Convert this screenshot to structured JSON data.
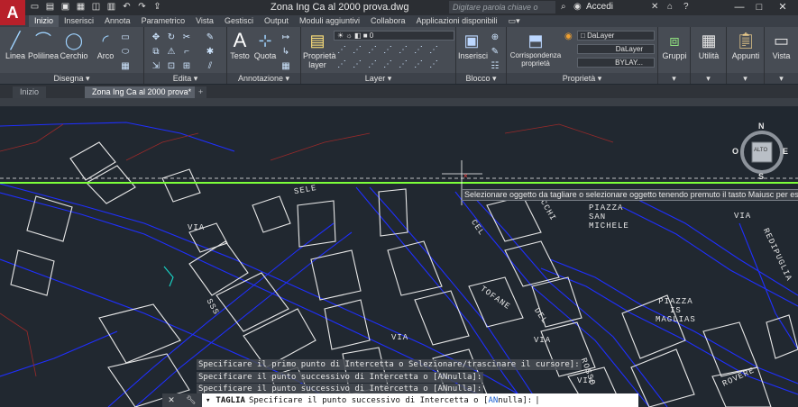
{
  "titlebar": {
    "app_letter": "A",
    "qat_icons": [
      "new-icon",
      "open-icon",
      "save-icon",
      "saveas-icon",
      "web-icon",
      "plot-icon",
      "undo-icon",
      "redo-icon",
      "share-icon"
    ],
    "doc_title": "Zona Ing Ca al 2000 prova.dwg",
    "search_placeholder": "Digitare parola chiave o frase",
    "login_label": "Accedi",
    "minimize": "—",
    "maximize": "□",
    "close": "✕"
  },
  "ribbon_tabs": [
    "Inizio",
    "Inserisci",
    "Annota",
    "Parametrico",
    "Vista",
    "Gestisci",
    "Output",
    "Moduli aggiuntivi",
    "Collabora",
    "Applicazioni disponibili"
  ],
  "ribbon": {
    "draw": {
      "label": "Disegna ▾",
      "tools": [
        "Linea",
        "Polilinea",
        "Cerchio",
        "Arco"
      ]
    },
    "modify": {
      "label": "Edita ▾"
    },
    "annotation": {
      "label": "Annotazione ▾",
      "tools": [
        "Testo",
        "Quota"
      ]
    },
    "layer": {
      "label": "Layer ▾",
      "props_label": "Proprietà layer",
      "current_layer": "0"
    },
    "block": {
      "label": "Blocco ▾",
      "insert_label": "Inserisci"
    },
    "properties": {
      "label": "Proprietà ▾",
      "match_label": "Corrispondenza proprietà",
      "color": "DaLayer",
      "linetype": "DaLayer",
      "lineweight": "BYLAY..."
    },
    "groups": {
      "label": "Gruppi"
    },
    "utilities": {
      "label": "Utilità"
    },
    "clipboard": {
      "label": "Appunti"
    },
    "view": {
      "label": "Vista"
    }
  },
  "doc_tabs": {
    "start": "Inizio",
    "active": "Zona Ing Ca al 2000 prova*",
    "add": "+"
  },
  "viewcube": {
    "n": "N",
    "s": "S",
    "e": "E",
    "w": "O",
    "face": "ALTO"
  },
  "tooltip": "Selezionare oggetto da tagliare o selezionare oggetto tenendo premuto il tasto Maiusc per estenderlo o",
  "map_labels": {
    "piazza_sm": [
      "PIAZZA",
      "SAN",
      "MICHELE"
    ],
    "piazza_m": [
      "PIAZZA",
      "IS",
      "MAGLIAS"
    ],
    "via1": "VIA",
    "via2": "VIA",
    "via3": "VIA",
    "via4": "VIA",
    "via5": "VIA",
    "tofane": "TOFANE",
    "del": "DEL",
    "cel": "CEL",
    "sss": "SSS",
    "rosso": "ROSSO",
    "redipuglia": "REDIPUGLIA",
    "rovere": "ROVERE",
    "ucchi": "UCCHI",
    "sele": "SELE"
  },
  "command_history": [
    "Specificare il primo punto di Intercetta o Selezionare/trascinare il cursore]:",
    "Specificare il punto successivo di Intercetta o [ANnulla]:",
    "Specificare il punto successivo di Intercetta o [ANnulla]:"
  ],
  "command_line": {
    "prefix": "TAGLIA",
    "prompt": "Specificare il punto successivo di Intercetta o [",
    "key": "AN",
    "suffix": "nulla]:"
  },
  "colors": {
    "background": "#212830",
    "roads": "#1f2fff",
    "buildings": "#e8e8e8",
    "green_line": "#7cff3a",
    "accent_red": "#b8202a"
  }
}
